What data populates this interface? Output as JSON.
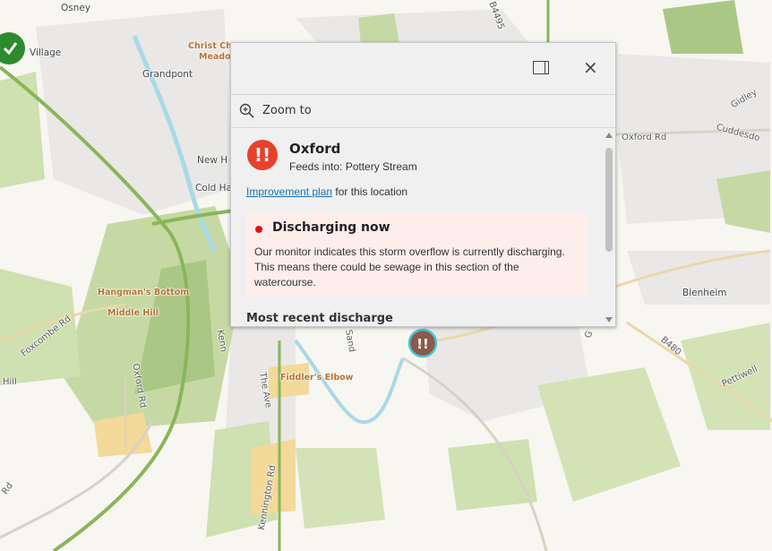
{
  "map": {
    "place_labels": [
      "Osney",
      "Village",
      "Grandpont",
      "New H",
      "Cold Ha",
      "Hangman's Bottom",
      "Middle Hill",
      "Foxcombe Rd",
      "Hill",
      "Oxford Rd",
      "Fiddler's Elbow",
      "The Ave",
      "Kennington Rd",
      "Kenn",
      "Sand",
      "Christ Chu",
      "Meado",
      "B4495",
      "Oxford Rd",
      "Gidley",
      "Cuddesdo",
      "Blenheim",
      "B480",
      "Pettiwell",
      "Rd",
      "G"
    ],
    "colors": {
      "green_area": "#c8dca7",
      "dark_green_area": "#a8c685",
      "urban": "#e6e6e6",
      "water": "#a9d9e8",
      "highlight": "#f4d89a",
      "road_green": "#8ab55a"
    }
  },
  "popup": {
    "dock_icon": "dock-panel-icon",
    "close_label": "×",
    "zoom_label": "Zoom to",
    "alert_symbol": "!!",
    "title": "Oxford",
    "feeds_into": "Feeds into: Pottery Stream",
    "plan_link": "Improvement plan",
    "plan_suffix": " for this location",
    "status_title": "Discharging now",
    "status_desc": "Our monitor indicates this storm overflow is currently discharging. This means there could be sewage in this section of the watercourse.",
    "recent_heading": "Most recent discharge"
  },
  "marker": {
    "icon": "sewage-overflow-marker-icon",
    "symbol": "!!"
  }
}
